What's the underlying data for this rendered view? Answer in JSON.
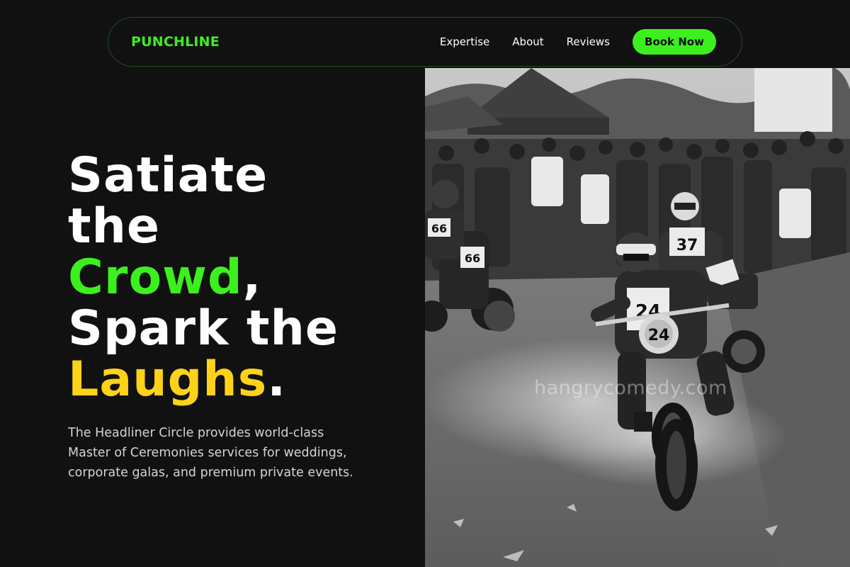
{
  "nav": {
    "logo": "PUNCHLINE",
    "links": [
      "Expertise",
      "About",
      "Reviews"
    ],
    "cta": "Book Now"
  },
  "hero": {
    "headline": {
      "line1": "Satiate",
      "line2": "the",
      "line3_accent": "Crowd",
      "line3_rest": ",",
      "line4": "Spark the",
      "line5_accent": "Laughs",
      "line5_rest": "."
    },
    "description": "The Headliner Circle provides world-class Master of Ceremonies services for weddings, corporate galas, and premium private events.",
    "image": {
      "alt": "hero-photo",
      "watermark": "hangrycomedy.com",
      "bib_numbers": [
        "66",
        "37",
        "24"
      ]
    }
  },
  "colors": {
    "background": "#111111",
    "accent_green": "#3cf01e",
    "accent_yellow": "#ffd21a",
    "text": "#ffffff",
    "muted_text": "#d4d4d4"
  }
}
